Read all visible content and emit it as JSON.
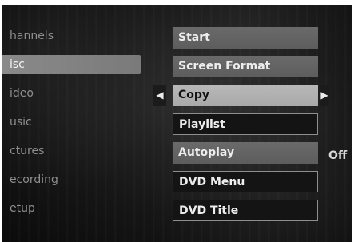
{
  "left_menu": {
    "items": [
      {
        "label": "hannels"
      },
      {
        "label": "isc"
      },
      {
        "label": "ideo"
      },
      {
        "label": "usic"
      },
      {
        "label": "ctures"
      },
      {
        "label": "ecording"
      },
      {
        "label": "etup"
      }
    ],
    "selected_index": 1
  },
  "options_menu": {
    "items": [
      {
        "label": "Start"
      },
      {
        "label": "Screen Format"
      },
      {
        "label": "Copy"
      },
      {
        "label": "Playlist"
      },
      {
        "label": "Autoplay",
        "value": "Off"
      },
      {
        "label": "DVD Menu"
      },
      {
        "label": "DVD Title"
      }
    ],
    "highlighted_index": 2
  },
  "icons": {
    "left_arrow": "◀",
    "right_arrow": "▶"
  }
}
